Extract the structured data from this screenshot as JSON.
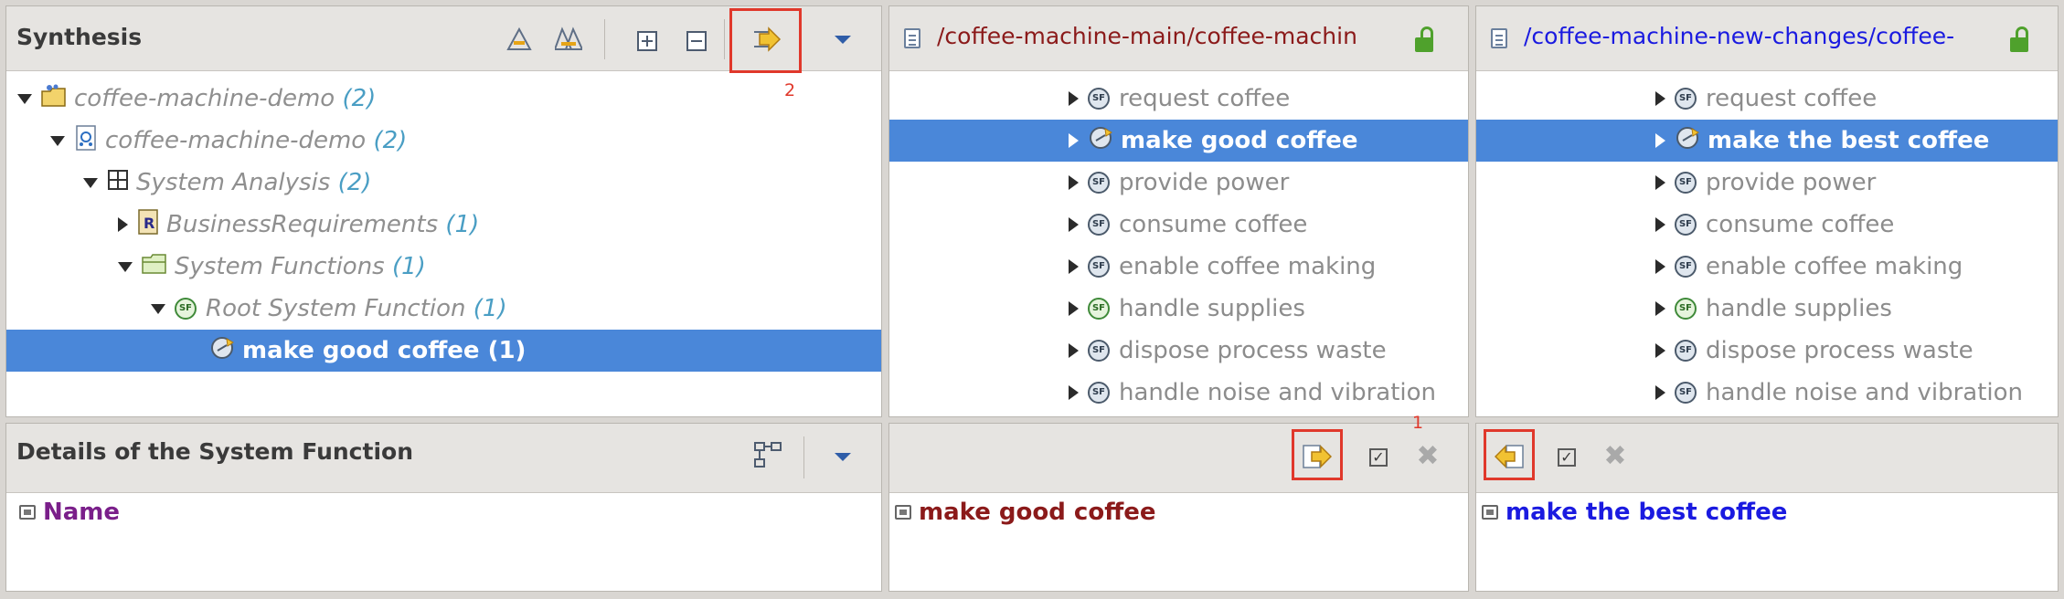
{
  "synthesis": {
    "title": "Synthesis",
    "icons": [
      "merge-all-icon",
      "merge-conflict-icon",
      "expand-all-icon",
      "collapse-all-icon",
      "apply-right-icon",
      "view-menu-dropdown-icon"
    ],
    "annotation": "2",
    "tree": [
      {
        "label": "coffee-machine-demo",
        "count": "(2)",
        "icon": "project-folder-icon",
        "expanded": true
      },
      {
        "label": "coffee-machine-demo",
        "count": "(2)",
        "icon": "model-icon",
        "expanded": true
      },
      {
        "label": "System Analysis",
        "count": "(2)",
        "icon": "system-analysis-icon",
        "expanded": true
      },
      {
        "label": "BusinessRequirements",
        "count": "(1)",
        "icon": "requirements-icon",
        "expanded": false
      },
      {
        "label": "System Functions",
        "count": "(1)",
        "icon": "folder-icon",
        "expanded": true
      },
      {
        "label": "Root System Function",
        "count": "(1)",
        "icon": "system-function-icon",
        "expanded": true
      },
      {
        "label": "make good coffee (1)",
        "count": "",
        "icon": "changed-function-icon",
        "selected": true
      }
    ]
  },
  "left_side": {
    "path": "/coffee-machine-main/coffee-machin",
    "path_color": "#8b1a1a",
    "items": [
      {
        "label": "request coffee"
      },
      {
        "label": "make good coffee",
        "selected": true
      },
      {
        "label": "provide power"
      },
      {
        "label": "consume coffee"
      },
      {
        "label": "enable coffee making"
      },
      {
        "label": "handle supplies"
      },
      {
        "label": "dispose process waste"
      },
      {
        "label": "handle noise and vibration"
      }
    ]
  },
  "right_side": {
    "path": "/coffee-machine-new-changes/coffee-",
    "path_color": "#1a1ae0",
    "items": [
      {
        "label": "request coffee"
      },
      {
        "label": "make the best coffee",
        "selected": true
      },
      {
        "label": "provide power"
      },
      {
        "label": "consume coffee"
      },
      {
        "label": "enable coffee making"
      },
      {
        "label": "handle supplies"
      },
      {
        "label": "dispose process waste"
      },
      {
        "label": "handle noise and vibration"
      }
    ]
  },
  "details": {
    "title": "Details of the System Function",
    "field_label": "Name",
    "field_color": "#7a1f8a"
  },
  "left_details": {
    "annotation": "1",
    "value": "make good coffee",
    "value_color": "#8b1a1a"
  },
  "right_details": {
    "value": "make the best coffee",
    "value_color": "#1a1ae0"
  },
  "colors": {
    "selection": "#4a87d9",
    "highlight_box": "#e0382b",
    "count": "#4a9ec4"
  }
}
